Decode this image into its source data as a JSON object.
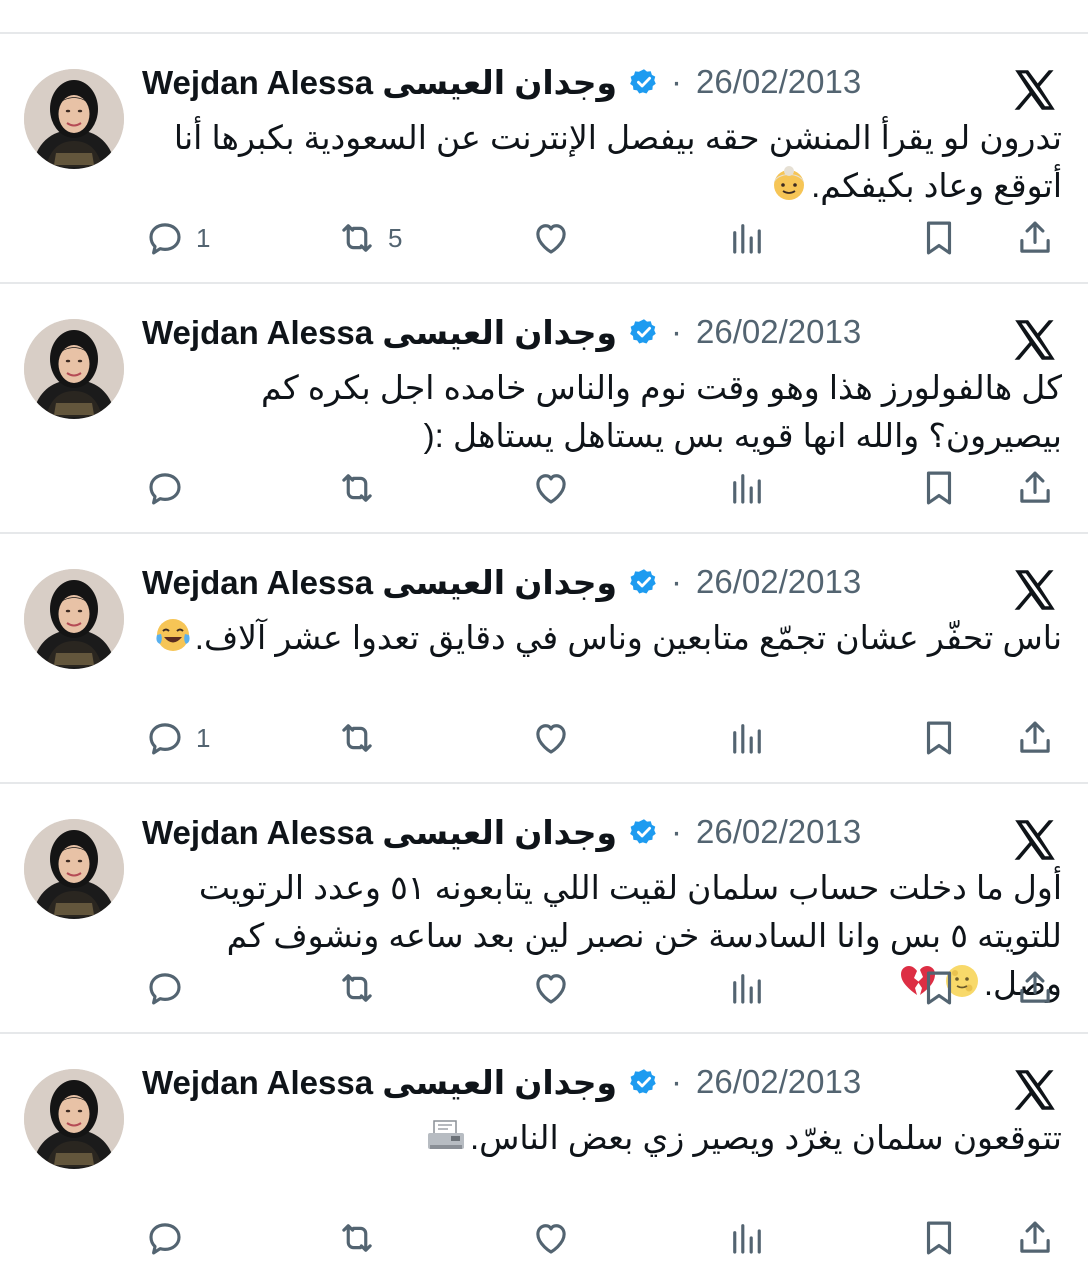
{
  "colors": {
    "text": "#0f1419",
    "muted": "#536471",
    "verified_blue": "#1d9bf0",
    "divider": "#e6e8ea"
  },
  "icons": {
    "reply": "reply-icon",
    "retweet": "retweet-icon",
    "like": "heart-icon",
    "views": "views-icon",
    "bookmark": "bookmark-icon",
    "share": "share-icon",
    "platform": "x-logo-icon",
    "verified": "verified-badge-icon"
  },
  "tweets": [
    {
      "author": "Wejdan Alessa وجدان العيسى",
      "separator": "·",
      "date": "26/02/2013",
      "text": "تدرون لو يقرأ المنشن حقه بيفصل الإنترنت عن السعودية بكبرها أنا أتوقع وعاد بكيفكم.",
      "emoji": [
        "older-woman"
      ],
      "reply_count": "1",
      "retweet_count": "5",
      "like_count": "",
      "view_count": ""
    },
    {
      "author": "Wejdan Alessa وجدان العيسى",
      "separator": "·",
      "date": "26/02/2013",
      "text": "كل هالفولورز هذا وهو وقت نوم والناس خامده اجل بكره كم بيصيرون؟ والله انها قويه بس يستاهل يستاهل :(",
      "emoji": [],
      "reply_count": "",
      "retweet_count": "",
      "like_count": "",
      "view_count": ""
    },
    {
      "author": "Wejdan Alessa وجدان العيسى",
      "separator": "·",
      "date": "26/02/2013",
      "text": "ناس تحفّر عشان تجمّع متابعين وناس في دقايق تعدوا عشر آلاف.",
      "emoji": [
        "tears-of-joy"
      ],
      "reply_count": "1",
      "retweet_count": "",
      "like_count": "",
      "view_count": ""
    },
    {
      "author": "Wejdan Alessa وجدان العيسى",
      "separator": "·",
      "date": "26/02/2013",
      "text": "أول ما دخلت حساب سلمان لقيت اللي يتابعونه ٥١ وعدد الرتويت للتويته ٥ بس وانا السادسة خن نصبر لين بعد ساعه ونشوف كم وصل.",
      "emoji": [
        "full-moon-face",
        "broken-heart"
      ],
      "reply_count": "",
      "retweet_count": "",
      "like_count": "",
      "view_count": ""
    },
    {
      "author": "Wejdan Alessa وجدان العيسى",
      "separator": "·",
      "date": "26/02/2013",
      "text": "تتوقعون سلمان يغرّد ويصير زي بعض الناس.",
      "emoji": [
        "fax-machine"
      ],
      "reply_count": "",
      "retweet_count": "",
      "like_count": "",
      "view_count": ""
    }
  ]
}
